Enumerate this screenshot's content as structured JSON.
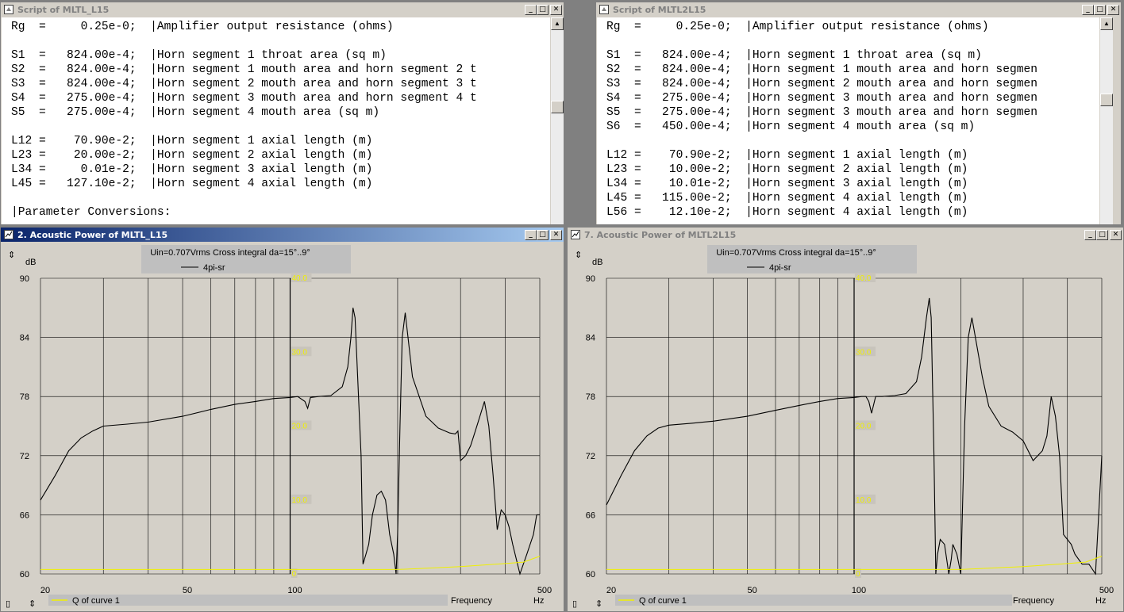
{
  "script_windows": [
    {
      "title": "Script of MLTL_L15",
      "lines": [
        "Rg  =     0.25e-0;  |Amplifier output resistance (ohms)",
        "",
        "S1  =   824.00e-4;  |Horn segment 1 throat area (sq m)",
        "S2  =   824.00e-4;  |Horn segment 1 mouth area and horn segment 2 t",
        "S3  =   824.00e-4;  |Horn segment 2 mouth area and horn segment 3 t",
        "S4  =   275.00e-4;  |Horn segment 3 mouth area and horn segment 4 t",
        "S5  =   275.00e-4;  |Horn segment 4 mouth area (sq m)",
        "",
        "L12 =    70.90e-2;  |Horn segment 1 axial length (m)",
        "L23 =    20.00e-2;  |Horn segment 2 axial length (m)",
        "L34 =     0.01e-2;  |Horn segment 3 axial length (m)",
        "L45 =   127.10e-2;  |Horn segment 4 axial length (m)",
        "",
        "|Parameter Conversions:"
      ]
    },
    {
      "title": "Script of MLTL2L15",
      "lines": [
        "Rg  =     0.25e-0;  |Amplifier output resistance (ohms)",
        "",
        "S1  =   824.00e-4;  |Horn segment 1 throat area (sq m)",
        "S2  =   824.00e-4;  |Horn segment 1 mouth area and horn segmen",
        "S3  =   824.00e-4;  |Horn segment 2 mouth area and horn segmen",
        "S4  =   275.00e-4;  |Horn segment 3 mouth area and horn segmen",
        "S5  =   275.00e-4;  |Horn segment 3 mouth area and horn segmen",
        "S6  =   450.00e-4;  |Horn segment 4 mouth area (sq m)",
        "",
        "L12 =    70.90e-2;  |Horn segment 1 axial length (m)",
        "L23 =    10.00e-2;  |Horn segment 2 axial length (m)",
        "L34 =    10.01e-2;  |Horn segment 3 axial length (m)",
        "L45 =   115.00e-2;  |Horn segment 4 axial length (m)",
        "L56 =    12.10e-2;  |Horn segment 4 axial length (m)"
      ]
    }
  ],
  "plot_windows": [
    {
      "title": "2. Acoustic Power of MLTL_L15",
      "active": true,
      "legend_title": "Uin=0.707Vrms Cross integral da=15°..9°",
      "legend_series": "4pi-sr",
      "y_unit": "dB",
      "x_name": "Frequency",
      "x_unit": "Hz",
      "q_legend": "Q of curve 1",
      "y_ticks": [
        "90",
        "84",
        "78",
        "72",
        "66",
        "60"
      ],
      "x_ticks": [
        "20",
        "50",
        "100",
        "500"
      ],
      "q_ticks": [
        "40.0",
        "30.0",
        "20.0",
        "10.0",
        "0"
      ],
      "colors": {
        "curve": "#000000",
        "q_curve": "#f0f000",
        "grid": "#000000"
      }
    },
    {
      "title": "7. Acoustic Power of MLTL2L15",
      "active": false,
      "legend_title": "Uin=0.707Vrms Cross integral da=15°..9°",
      "legend_series": "4pi-sr",
      "y_unit": "dB",
      "x_name": "Frequency",
      "x_unit": "Hz",
      "q_legend": "Q of curve 1",
      "y_ticks": [
        "90",
        "84",
        "78",
        "72",
        "66",
        "60"
      ],
      "x_ticks": [
        "20",
        "50",
        "100",
        "500"
      ],
      "q_ticks": [
        "40.0",
        "30.0",
        "20.0",
        "10.0",
        "0"
      ],
      "colors": {
        "curve": "#000000",
        "q_curve": "#f0f000",
        "grid": "#000000"
      }
    }
  ],
  "chart_data": [
    {
      "type": "line",
      "title": "2. Acoustic Power of MLTL_L15",
      "xlabel": "Frequency",
      "ylabel": "dB",
      "xscale": "log",
      "xlim": [
        20,
        500
      ],
      "ylim": [
        60,
        90
      ],
      "grid": true,
      "legend_placement": "top",
      "series": [
        {
          "name": "4pi-sr",
          "x": [
            20,
            22,
            24,
            26,
            28,
            30,
            35,
            40,
            50,
            60,
            70,
            80,
            90,
            100,
            105,
            110,
            112,
            114,
            120,
            130,
            140,
            145,
            148,
            150,
            152,
            155,
            158,
            160,
            163,
            166,
            170,
            175,
            180,
            185,
            190,
            195,
            198,
            200,
            203,
            206,
            210,
            220,
            240,
            260,
            280,
            290,
            295,
            300,
            310,
            320,
            330,
            340,
            350,
            360,
            370,
            380,
            390,
            400,
            410,
            420,
            440,
            460,
            480,
            490,
            500
          ],
          "y": [
            67.5,
            70,
            72.5,
            73.8,
            74.5,
            75,
            75.2,
            75.4,
            76,
            76.7,
            77.2,
            77.5,
            77.8,
            77.9,
            78,
            77.5,
            76.8,
            77.9,
            78,
            78.1,
            79,
            81,
            84,
            87,
            86,
            79,
            72,
            61,
            62,
            63,
            66,
            68,
            68.4,
            67.5,
            64,
            62,
            60,
            64,
            75,
            84,
            86.5,
            80,
            76,
            74.8,
            74.3,
            74.2,
            74.5,
            71.5,
            72,
            73,
            74.5,
            76,
            77.5,
            75,
            70,
            64.5,
            66.5,
            66,
            64.8,
            63,
            60,
            62,
            64,
            66,
            66
          ]
        },
        {
          "name": "Q of curve 1",
          "x": [
            20,
            100,
            200,
            300,
            400,
            450,
            500
          ],
          "y_q": [
            0.6,
            0.6,
            0.6,
            1,
            1.4,
            1.6,
            2.4
          ]
        }
      ]
    },
    {
      "type": "line",
      "title": "7. Acoustic Power of MLTL2L15",
      "xlabel": "Frequency",
      "ylabel": "dB",
      "xscale": "log",
      "xlim": [
        20,
        500
      ],
      "ylim": [
        60,
        90
      ],
      "grid": true,
      "legend_placement": "top",
      "series": [
        {
          "name": "4pi-sr",
          "x": [
            20,
            22,
            24,
            26,
            28,
            30,
            35,
            40,
            50,
            60,
            70,
            80,
            90,
            100,
            105,
            108,
            110,
            112,
            115,
            120,
            130,
            140,
            150,
            155,
            160,
            163,
            165,
            168,
            170,
            172,
            175,
            180,
            185,
            188,
            190,
            195,
            200,
            205,
            210,
            215,
            220,
            230,
            240,
            260,
            280,
            300,
            320,
            340,
            350,
            360,
            370,
            380,
            390,
            400,
            410,
            420,
            440,
            460,
            480,
            490,
            500
          ],
          "y": [
            67,
            70,
            72.5,
            74,
            74.8,
            75.1,
            75.3,
            75.5,
            76,
            76.6,
            77.1,
            77.5,
            77.8,
            77.9,
            78,
            78,
            77.5,
            76.3,
            78,
            78,
            78.1,
            78.3,
            79.5,
            82,
            86,
            88,
            86,
            72,
            60,
            62,
            63.5,
            63,
            60,
            61.5,
            63,
            62,
            60,
            75,
            84,
            86,
            84,
            80,
            77,
            75,
            74.4,
            73.5,
            71.5,
            72.5,
            74,
            78,
            76,
            72,
            64,
            63.5,
            63,
            62,
            61,
            61,
            60,
            66,
            72
          ]
        },
        {
          "name": "Q of curve 1",
          "x": [
            20,
            100,
            200,
            300,
            400,
            450,
            500
          ],
          "y_q": [
            0.6,
            0.6,
            0.6,
            1,
            1.4,
            1.6,
            2.4
          ]
        }
      ]
    }
  ]
}
